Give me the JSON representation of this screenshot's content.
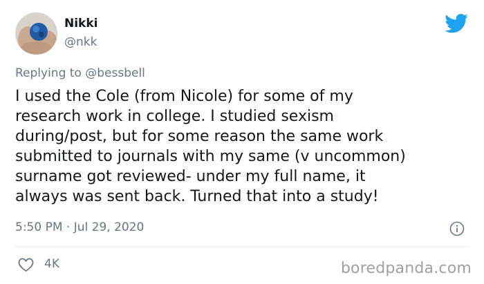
{
  "author": {
    "name": "Nikki",
    "handle": "@nkk"
  },
  "reply": {
    "prefix": "Replying to",
    "mention": "@bessbell"
  },
  "tweet": {
    "lines": [
      "I used the Cole (from Nicole) for some of my",
      "research work in college. I studied sexism",
      "during/post, but for some reason the same work",
      "submitted to journals with my same (v uncommon)",
      "surname got reviewed- under my full name, it",
      "always was sent back. Turned that into a study!"
    ],
    "timestamp": "5:50 PM · Jul 29, 2020",
    "likes": "4K"
  },
  "watermark": "boredpanda.com",
  "colors": {
    "twitter_blue": "#1da1f2",
    "secondary_text": "#657786"
  },
  "icons": {
    "brand": "twitter-bird-icon",
    "info": "info-icon",
    "like": "heart-icon"
  }
}
